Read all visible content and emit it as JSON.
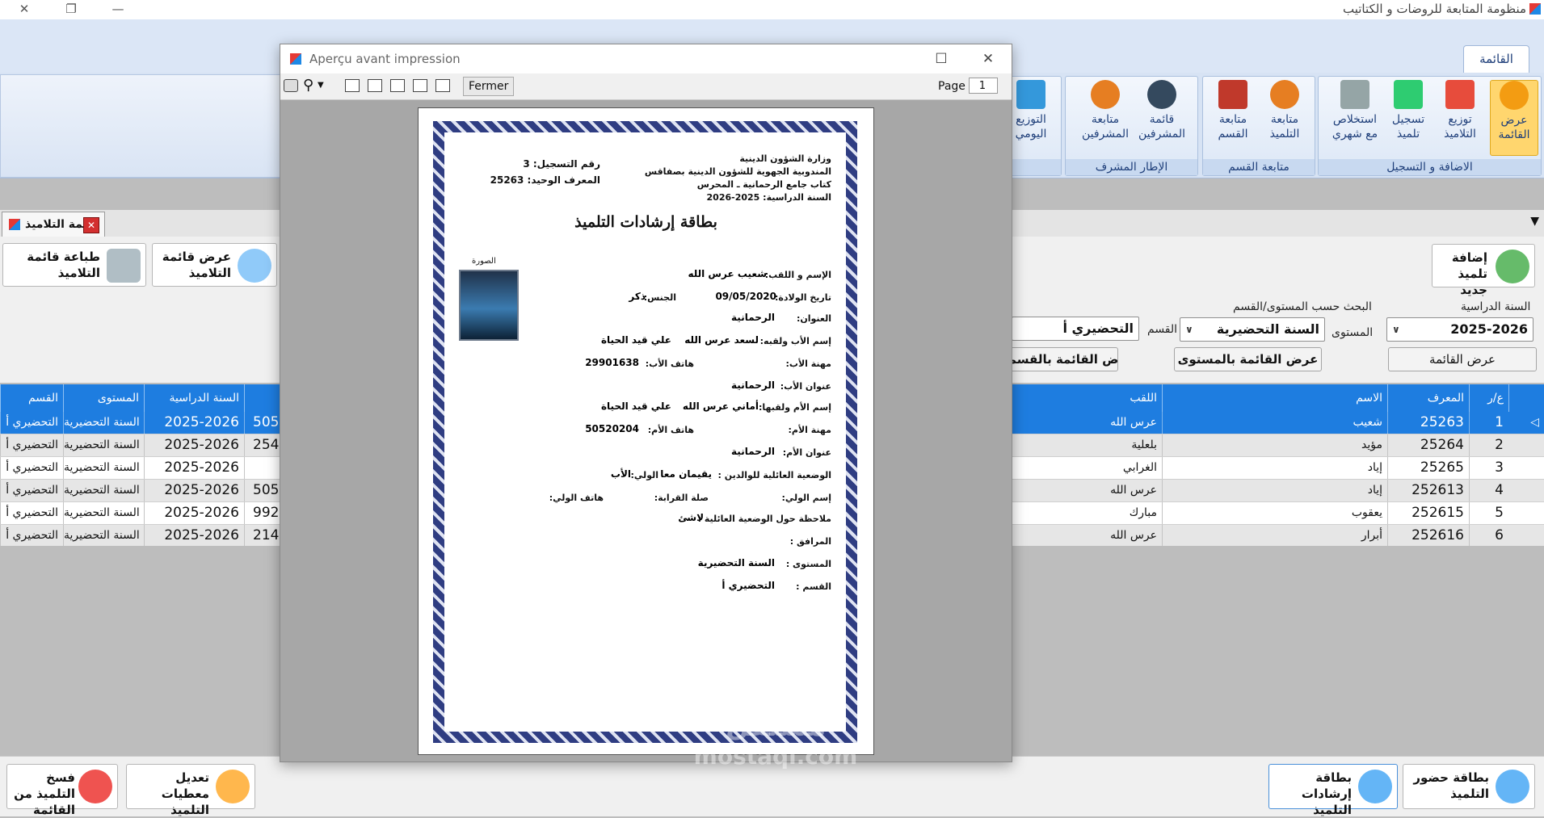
{
  "app": {
    "title": "منظومة المتابعة للروضات و الكتاتيب"
  },
  "ribbon": {
    "tab": "القائمة",
    "groups": [
      {
        "label": "الاضافة و التسجيل",
        "buttons": [
          "عرض القائمة",
          "توزيع التلاميذ",
          "تسجيل تلميذ",
          "استخلاص مع شهري"
        ]
      },
      {
        "label": "متابعة القسم",
        "buttons": [
          "متابعة التلميذ",
          "متابعة القسم"
        ]
      },
      {
        "label": "الإطار المشرف",
        "buttons": [
          "قائمة المشرفين",
          "متابعة المشرفين"
        ]
      },
      {
        "label": "",
        "buttons": [
          "التوزيع اليومي"
        ]
      }
    ]
  },
  "doc_tab": {
    "label": "قائمة التلاميذ",
    "close": "✕"
  },
  "toolbar": {
    "print_list": "طباعة قائمة التلاميذ",
    "show_list": "عرض قائمة التلاميذ",
    "add_student": "إضافة تلميذ جديد"
  },
  "filters": {
    "year_label": "السنة الدراسية",
    "year_value": "2025-2026",
    "show_list_btn": "عرض القائمة",
    "search_group_label": "البحث حسب المستوى/القسم",
    "level_label": "المستوى",
    "level_value": "السنة التحضيرية",
    "section_label": "القسم",
    "section_value": "التحضيري أ",
    "by_level_btn": "عرض القائمة بالمستوى",
    "by_section_btn": "عرض القائمة بالقسم"
  },
  "grid": {
    "headers": {
      "num": "ع/ر",
      "id": "المعرف",
      "name": "الاسم",
      "lastname": "اللقب",
      "year": "السنة الدراسية",
      "level": "المستوى",
      "section": "القسم"
    },
    "rows": [
      {
        "num": "1",
        "id": "25263",
        "name": "شعيب",
        "lastname": "عرس الله",
        "phone": "505",
        "year": "2025-2026",
        "level": "السنة التحضيرية",
        "section": "التحضيري أ"
      },
      {
        "num": "2",
        "id": "25264",
        "name": "مؤيد",
        "lastname": "بلعلية",
        "phone": "254",
        "year": "2025-2026",
        "level": "السنة التحضيرية",
        "section": "التحضيري أ"
      },
      {
        "num": "3",
        "id": "25265",
        "name": "إياد",
        "lastname": "الغرابي",
        "phone": "",
        "year": "2025-2026",
        "level": "السنة التحضيرية",
        "section": "التحضيري أ"
      },
      {
        "num": "4",
        "id": "252613",
        "name": "إياد",
        "lastname": "عرس الله",
        "phone": "505",
        "year": "2025-2026",
        "level": "السنة التحضيرية",
        "section": "التحضيري أ"
      },
      {
        "num": "5",
        "id": "252615",
        "name": "يعقوب",
        "lastname": "مبارك",
        "phone": "992",
        "year": "2025-2026",
        "level": "السنة التحضيرية",
        "section": "التحضيري أ"
      },
      {
        "num": "6",
        "id": "252616",
        "name": "أبرار",
        "lastname": "عرس الله",
        "phone": "214",
        "year": "2025-2026",
        "level": "السنة التحضيرية",
        "section": "التحضيري أ"
      }
    ]
  },
  "bottom": {
    "delete_student": "فسخ التلميذ من القائمة",
    "edit_student": "تعديل معطيات التلميذ",
    "guidance_card": "بطاقة إرشادات التلميذ",
    "attendance_card": "بطاقة حضور التلميذ"
  },
  "dialog": {
    "title": "Aperçu avant impression",
    "close_btn": "Fermer",
    "page_label": "Page",
    "page_value": "1"
  },
  "card": {
    "ministry": "وزارة الشؤون الدينية",
    "regional": "المندوبية الجهوية للشؤون الدينية بصفاقس",
    "kuttab": "كتاب جامع الرحمانية ـ المحرس",
    "school_year": "السنة الدراسية: 2025-2026",
    "reg_num": "رقم التسجيل: 3",
    "unique_id": "المعرف الوحيد: 25263",
    "title": "بطاقة إرشادات التلميذ",
    "photo_label": "الصورة",
    "fields": [
      {
        "label": "الإسم و اللقب:",
        "value": "شعيب   عرس الله"
      },
      {
        "label": "تاريخ الولادة:",
        "value": "09/05/2020"
      },
      {
        "label": "الجنس:",
        "value": "ذكر"
      },
      {
        "label": "العنوان:",
        "value": "الرحمانية"
      },
      {
        "label": "إسم الأب ولقبه:",
        "value": "لسعد  عرس الله"
      },
      {
        "label": "",
        "value": "علي قيد الحياة"
      },
      {
        "label": "مهنة الأب:",
        "value": ""
      },
      {
        "label": "هاتف الأب:",
        "value": "29901638"
      },
      {
        "label": "عنوان الأب:",
        "value": "الرحمانية"
      },
      {
        "label": "إسم الأم ولقبها:",
        "value": "أماني عرس الله"
      },
      {
        "label": "",
        "value": "علي قيد الحياة"
      },
      {
        "label": "مهنة الأم:",
        "value": ""
      },
      {
        "label": "هاتف الأم:",
        "value": "50520204"
      },
      {
        "label": "عنوان الأم:",
        "value": "الرحمانية"
      },
      {
        "label": "الوضعية العائلية للوالدين :",
        "value": "يقيمان معا"
      },
      {
        "label": "الولي:",
        "value": "الأب"
      },
      {
        "label": "إسم الولي:",
        "value": ""
      },
      {
        "label": "صلة القرابة:",
        "value": ""
      },
      {
        "label": "هاتف الولي:",
        "value": ""
      },
      {
        "label": "ملاحظة حول الوضعية العائلية :",
        "value": "لاشئ"
      },
      {
        "label": "المرافق :",
        "value": ""
      },
      {
        "label": "المستوى :",
        "value": "السنة التحضيرية"
      },
      {
        "label": "القسم :",
        "value": "التحضيري أ"
      }
    ]
  },
  "watermark": {
    "line1": "مستقل",
    "line2": "mostaql.com"
  }
}
